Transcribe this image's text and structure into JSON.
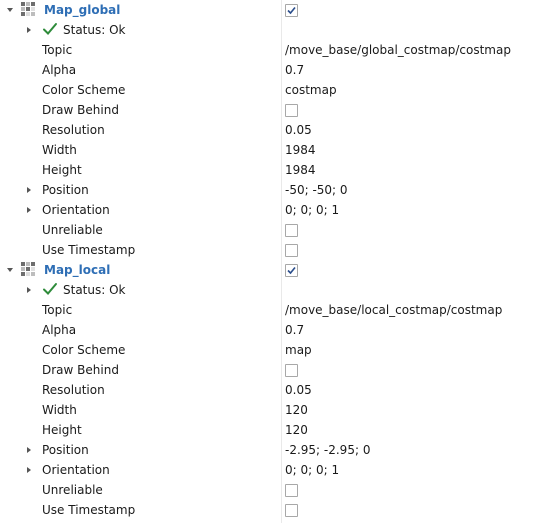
{
  "displays": [
    {
      "name": "Map_global",
      "enabled": true,
      "status": "Status: Ok",
      "properties": [
        {
          "label": "Topic",
          "value": "/move_base/global_costmap/costmap"
        },
        {
          "label": "Alpha",
          "value": "0.7"
        },
        {
          "label": "Color Scheme",
          "value": "costmap"
        },
        {
          "label": "Draw Behind",
          "checked": false
        },
        {
          "label": "Resolution",
          "value": "0.05"
        },
        {
          "label": "Width",
          "value": "1984"
        },
        {
          "label": "Height",
          "value": "1984"
        },
        {
          "label": "Position",
          "value": "-50; -50; 0",
          "expandable": true
        },
        {
          "label": "Orientation",
          "value": "0; 0; 0; 1",
          "expandable": true
        },
        {
          "label": "Unreliable",
          "checked": false
        },
        {
          "label": "Use Timestamp",
          "checked": false
        }
      ]
    },
    {
      "name": "Map_local",
      "enabled": true,
      "status": "Status: Ok",
      "properties": [
        {
          "label": "Topic",
          "value": "/move_base/local_costmap/costmap"
        },
        {
          "label": "Alpha",
          "value": "0.7"
        },
        {
          "label": "Color Scheme",
          "value": "map"
        },
        {
          "label": "Draw Behind",
          "checked": false
        },
        {
          "label": "Resolution",
          "value": "0.05"
        },
        {
          "label": "Width",
          "value": "120"
        },
        {
          "label": "Height",
          "value": "120"
        },
        {
          "label": "Position",
          "value": "-2.95; -2.95; 0",
          "expandable": true
        },
        {
          "label": "Orientation",
          "value": "0; 0; 0; 1",
          "expandable": true
        },
        {
          "label": "Unreliable",
          "checked": false
        },
        {
          "label": "Use Timestamp",
          "checked": false
        }
      ]
    }
  ],
  "colors": {
    "display_name": "#2e6eb5",
    "status_check": "#2e8b3a",
    "checkbox_border": "#a8a8a8",
    "divider": "#e9e9e9"
  },
  "icons": {
    "display_icon": "map-icon",
    "status_icon": "checkmark-icon",
    "expand_collapsed": "chevron-right-icon",
    "expand_expanded": "chevron-down-icon"
  }
}
